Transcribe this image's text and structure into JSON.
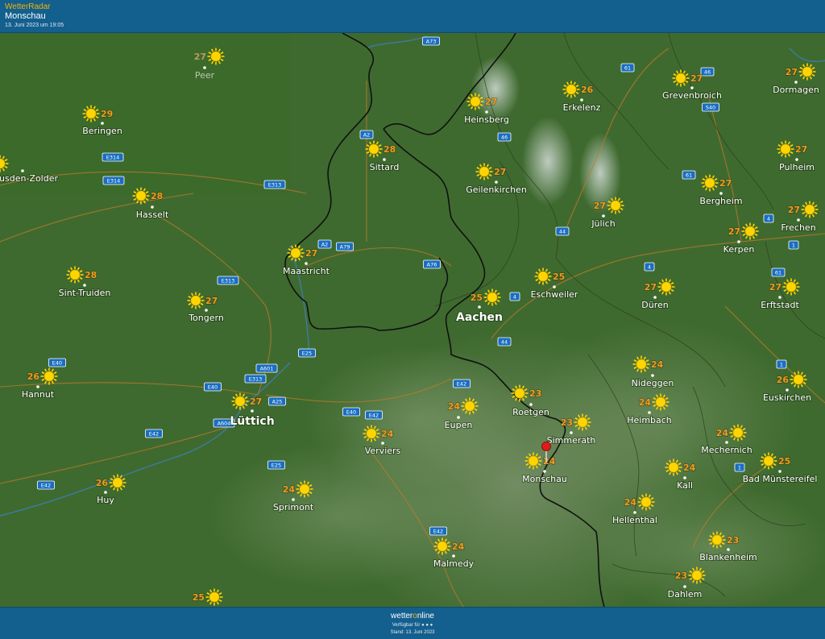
{
  "header": {
    "app_name": "WetterRadar",
    "location": "Monschau",
    "datetime": "13. Juni 2023 um 19:05"
  },
  "footer": {
    "brand_left": "wetter",
    "brand_o": "o",
    "brand_right": "nline",
    "availability": "Verfügbar für",
    "stand": "Stand: 13. Juni 2023"
  },
  "colors": {
    "header_bg": "#135f8e",
    "app_name": "#f4b400",
    "terrain": "#3f6a2f",
    "temperature": "#f39a1b",
    "sun": "#ffd500",
    "border": "#111111",
    "road": "#c27a2c",
    "river": "#3d7fbf",
    "pin": "#e01b1b"
  },
  "icons": {
    "weather": "sun-icon",
    "marker": "location-pin-icon"
  },
  "cities": [
    {
      "name": "Peer",
      "temp": "27",
      "faint": true
    },
    {
      "name": "Beringen",
      "temp": "29"
    },
    {
      "name": "Heusden-Zolder",
      "temp": ""
    },
    {
      "name": "Hasselt",
      "temp": "28"
    },
    {
      "name": "Sint-Truiden",
      "temp": "28"
    },
    {
      "name": "Tongern",
      "temp": "27"
    },
    {
      "name": "Hannut",
      "temp": "26"
    },
    {
      "name": "Huy",
      "temp": "26"
    },
    {
      "name": "Lüttich",
      "temp": "27",
      "big": true
    },
    {
      "name": "Sprimont",
      "temp": "24"
    },
    {
      "name": "Verviers",
      "temp": "24"
    },
    {
      "name": "Maastricht",
      "temp": "27"
    },
    {
      "name": "Sittard",
      "temp": "28"
    },
    {
      "name": "Heinsberg",
      "temp": "27"
    },
    {
      "name": "Erkelenz",
      "temp": "26"
    },
    {
      "name": "Grevenbroich",
      "temp": "27"
    },
    {
      "name": "Dormagen",
      "temp": "27"
    },
    {
      "name": "Geilenkirchen",
      "temp": "27"
    },
    {
      "name": "Jülich",
      "temp": "27"
    },
    {
      "name": "Bergheim",
      "temp": "27"
    },
    {
      "name": "Pulheim",
      "temp": "27"
    },
    {
      "name": "Frechen",
      "temp": "27"
    },
    {
      "name": "Kerpen",
      "temp": "27"
    },
    {
      "name": "Aachen",
      "temp": "25",
      "big": true
    },
    {
      "name": "Eschweiler",
      "temp": "25"
    },
    {
      "name": "Düren",
      "temp": "27"
    },
    {
      "name": "Erftstadt",
      "temp": "27"
    },
    {
      "name": "Eupen",
      "temp": "24"
    },
    {
      "name": "Roetgen",
      "temp": "23"
    },
    {
      "name": "Nideggen",
      "temp": "24"
    },
    {
      "name": "Euskirchen",
      "temp": "26"
    },
    {
      "name": "Simmerath",
      "temp": "23"
    },
    {
      "name": "Heimbach",
      "temp": "24"
    },
    {
      "name": "Mechernich",
      "temp": "24"
    },
    {
      "name": "Monschau",
      "temp": "24"
    },
    {
      "name": "Kall",
      "temp": "24"
    },
    {
      "name": "Bad Münstereifel",
      "temp": "25"
    },
    {
      "name": "Hellenthal",
      "temp": "24"
    },
    {
      "name": "Malmedy",
      "temp": "24"
    },
    {
      "name": "Blankenheim",
      "temp": "23"
    },
    {
      "name": "Dahlem",
      "temp": "23"
    },
    {
      "name": "",
      "temp": "25"
    }
  ],
  "road_labels": [
    "A73",
    "61",
    "46",
    "S40",
    "A2",
    "46",
    "E314",
    "E313",
    "E314",
    "61",
    "4",
    "1",
    "A2",
    "A79",
    "A76",
    "44",
    "4",
    "61",
    "4",
    "E313",
    "E25",
    "A601",
    "E313",
    "E40",
    "E40",
    "A25",
    "E40",
    "E42",
    "A604",
    "E42",
    "44",
    "E42",
    "1",
    "1",
    "E25",
    "E42",
    "E42"
  ]
}
